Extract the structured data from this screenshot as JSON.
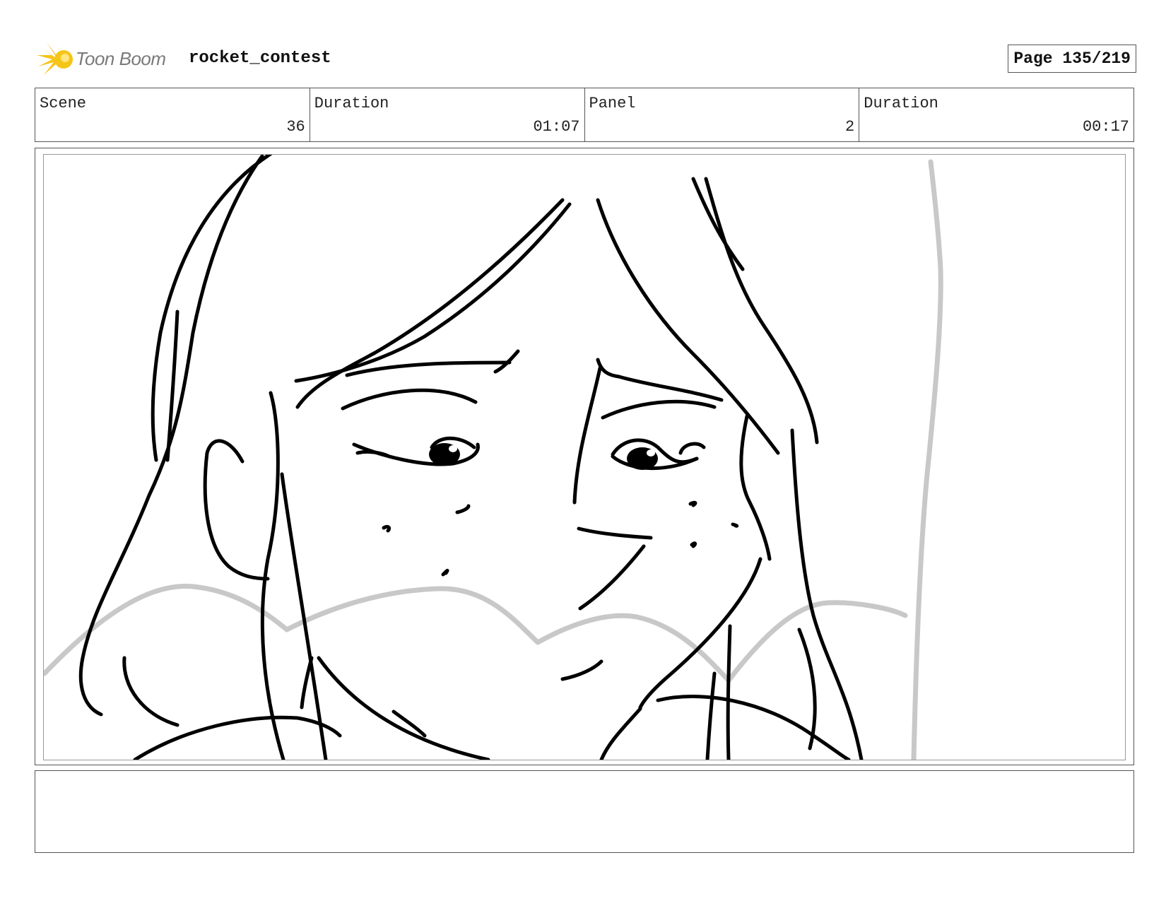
{
  "header": {
    "logo_text": "Toon Boom",
    "project_name": "rocket_contest",
    "page_label": "Page 135/219"
  },
  "info": {
    "scene_label": "Scene",
    "scene_value": "36",
    "scene_duration_label": "Duration",
    "scene_duration_value": "01:07",
    "panel_label": "Panel",
    "panel_value": "2",
    "panel_duration_label": "Duration",
    "panel_duration_value": "00:17"
  },
  "notes": {
    "text": ""
  },
  "icons": {
    "logo": "toon-boom-starburst-icon"
  },
  "colors": {
    "logo_yellow": "#f5c518",
    "sketch_line": "#000000",
    "sketch_guide": "#c8c8c8"
  }
}
